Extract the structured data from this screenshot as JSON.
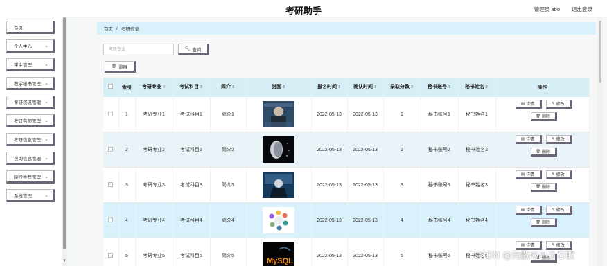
{
  "header": {
    "title": "考研助手",
    "admin": "管理员 abo",
    "logout": "退出登录"
  },
  "sidebar": {
    "items": [
      {
        "label": "首页",
        "chevron": false
      },
      {
        "label": "个人中心",
        "chevron": true
      },
      {
        "label": "学生管理",
        "chevron": true
      },
      {
        "label": "教学秘书管理",
        "chevron": true
      },
      {
        "label": "考研资讯管理",
        "chevron": true
      },
      {
        "label": "考研名师管理",
        "chevron": true
      },
      {
        "label": "考研信息管理",
        "chevron": true
      },
      {
        "label": "咨询信息管理",
        "chevron": true
      },
      {
        "label": "院校推荐管理",
        "chevron": true
      },
      {
        "label": "系统管理",
        "chevron": true
      }
    ]
  },
  "breadcrumb": {
    "home": "首页",
    "separator": "/",
    "current": "考研信息"
  },
  "search": {
    "placeholder": "考研专业",
    "button": "查询"
  },
  "toolbar": {
    "delete": "删除"
  },
  "table": {
    "headers": [
      "索引",
      "考研专业",
      "考试科目",
      "简介",
      "封面",
      "报名时间",
      "确认时间",
      "录取分数",
      "秘书账号",
      "秘书姓名",
      "操作"
    ],
    "rows": [
      {
        "index": "1",
        "major": "考研专业1",
        "subject": "考试科目1",
        "intro": "简介1",
        "signup": "2022-05-13",
        "confirm": "2022-05-13",
        "score": "1",
        "account": "秘书账号1",
        "name": "秘书姓名1"
      },
      {
        "index": "2",
        "major": "考研专业2",
        "subject": "考试科目2",
        "intro": "简介2",
        "signup": "2022-05-13",
        "confirm": "2022-05-13",
        "score": "2",
        "account": "秘书账号2",
        "name": "秘书姓名2"
      },
      {
        "index": "3",
        "major": "考研专业3",
        "subject": "考试科目3",
        "intro": "简介3",
        "signup": "2022-05-13",
        "confirm": "2022-05-13",
        "score": "3",
        "account": "秘书账号3",
        "name": "秘书姓名3"
      },
      {
        "index": "4",
        "major": "考研专业4",
        "subject": "考试科目4",
        "intro": "简介4",
        "signup": "2022-05-13",
        "confirm": "2022-05-13",
        "score": "4",
        "account": "秘书账号4",
        "name": "秘书姓名4"
      },
      {
        "index": "5",
        "major": "考研专业5",
        "subject": "考试科目5",
        "intro": "简介5",
        "signup": "2022-05-13",
        "confirm": "2022-05-13",
        "score": "5",
        "account": "秘书账号5",
        "name": "秘书姓名5"
      }
    ],
    "actions": {
      "detail": "详情",
      "edit": "修改",
      "delete": "删除"
    },
    "cover_mysql_text": "MySQL"
  },
  "watermark": "CSDN @元散の小さな蚊",
  "colors": {
    "header_bar": "#d6eff7",
    "breadcrumb_bg": "#d9f1fb",
    "button_shadow": "#6b6578"
  }
}
